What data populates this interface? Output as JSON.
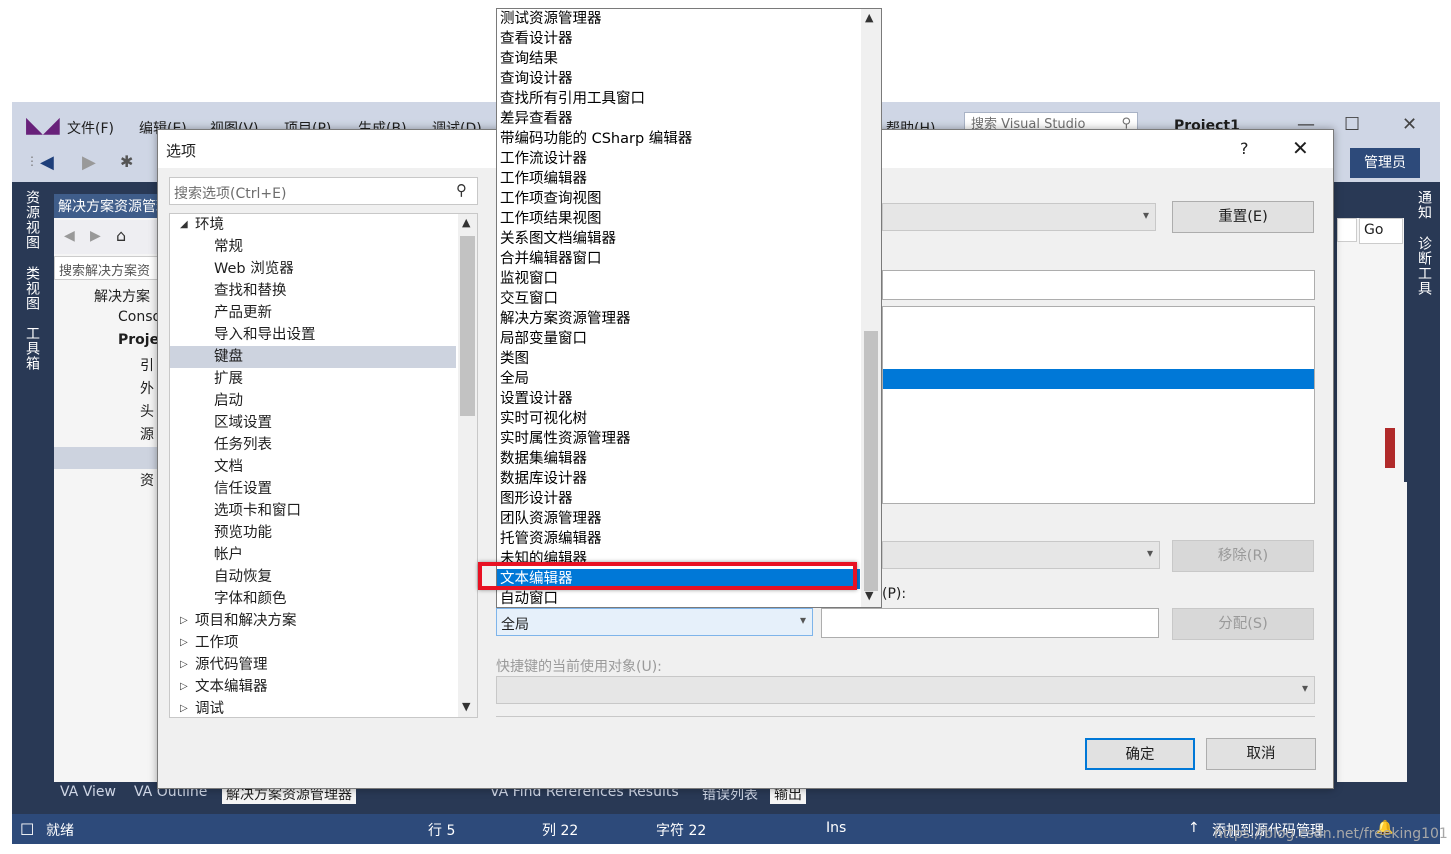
{
  "vs": {
    "menu": [
      "文件(F)",
      "编辑(E)",
      "视图(V)",
      "项目(P)",
      "生成(B)",
      "调试(D)",
      "帮助(H)"
    ],
    "search_placeholder": "搜索 Visual Studio",
    "project": "Project1",
    "admin": "管理员",
    "left_tabs": [
      "资源视图",
      "类视图",
      "工具箱"
    ],
    "right_tabs": [
      "通知",
      "诊断工具"
    ],
    "solution_explorer": {
      "title": "解决方案资源管理器",
      "search": "搜索解决方案资",
      "rows": [
        "解决方案",
        "Conso",
        "Proje",
        "引",
        "外",
        "头",
        "源",
        "",
        "资"
      ]
    },
    "bottom_tabs": [
      "VA View",
      "VA Outline",
      "解决方案资源管理器",
      "VA Find References Results",
      "错误列表",
      "输出"
    ],
    "status": {
      "ready": "就绪",
      "line": "行 5",
      "col": "列 22",
      "char": "字符 22",
      "ins": "Ins",
      "source_control": "添加到源代码管理"
    },
    "go_button": "Go",
    "accent_color": "#0078d7"
  },
  "dialog": {
    "title": "选项",
    "help": "?",
    "search_placeholder": "搜索选项(Ctrl+E)",
    "tree": [
      {
        "label": "环境",
        "level": 0,
        "expanded": true
      },
      {
        "label": "常规",
        "level": 1
      },
      {
        "label": "Web 浏览器",
        "level": 1
      },
      {
        "label": "查找和替换",
        "level": 1
      },
      {
        "label": "产品更新",
        "level": 1
      },
      {
        "label": "导入和导出设置",
        "level": 1
      },
      {
        "label": "键盘",
        "level": 1,
        "selected": true
      },
      {
        "label": "扩展",
        "level": 1
      },
      {
        "label": "启动",
        "level": 1
      },
      {
        "label": "区域设置",
        "level": 1
      },
      {
        "label": "任务列表",
        "level": 1
      },
      {
        "label": "文档",
        "level": 1
      },
      {
        "label": "信任设置",
        "level": 1
      },
      {
        "label": "选项卡和窗口",
        "level": 1
      },
      {
        "label": "预览功能",
        "level": 1
      },
      {
        "label": "帐户",
        "level": 1
      },
      {
        "label": "自动恢复",
        "level": 1
      },
      {
        "label": "字体和颜色",
        "level": 1
      },
      {
        "label": "项目和解决方案",
        "level": 0
      },
      {
        "label": "工作项",
        "level": 0
      },
      {
        "label": "源代码管理",
        "level": 0
      },
      {
        "label": "文本编辑器",
        "level": 0
      },
      {
        "label": "调试",
        "level": 0
      }
    ],
    "reset_button": "重置(E)",
    "remove_button": "移除(R)",
    "assign_button": "分配(S)",
    "shortcut_label_suffix": "(P):",
    "scope_value": "全局",
    "current_use_label": "快捷键的当前使用对象(U):",
    "ok_button": "确定",
    "cancel_button": "取消"
  },
  "dropdown": {
    "items": [
      "测试资源管理器",
      "查看设计器",
      "查询结果",
      "查询设计器",
      "查找所有引用工具窗口",
      "差异查看器",
      "带编码功能的 CSharp 编辑器",
      "工作流设计器",
      "工作项编辑器",
      "工作项查询视图",
      "工作项结果视图",
      "关系图文档编辑器",
      "合并编辑器窗口",
      "监视窗口",
      "交互窗口",
      "解决方案资源管理器",
      "局部变量窗口",
      "类图",
      "全局",
      "设置设计器",
      "实时可视化树",
      "实时属性资源管理器",
      "数据集编辑器",
      "数据库设计器",
      "图形设计器",
      "团队资源管理器",
      "托管资源编辑器",
      "未知的编辑器",
      "文本编辑器",
      "自动窗口"
    ],
    "selected": "文本编辑器"
  },
  "watermark": "https://blog.csdn.net/freeking101"
}
